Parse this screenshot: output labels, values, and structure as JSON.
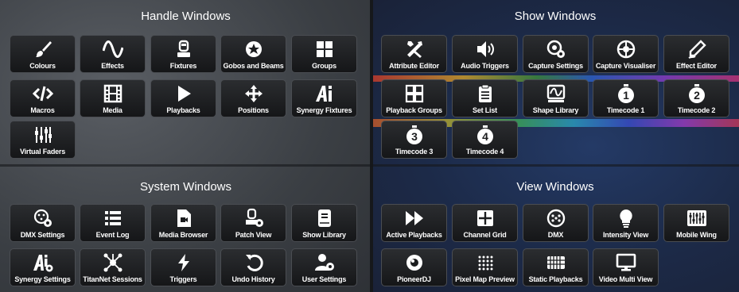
{
  "sections": {
    "handle": {
      "title": "Handle Windows",
      "items": [
        {
          "label": "Colours",
          "icon": "brush-icon"
        },
        {
          "label": "Effects",
          "icon": "sine-wave-icon"
        },
        {
          "label": "Fixtures",
          "icon": "fixture-icon"
        },
        {
          "label": "Gobos and Beams",
          "icon": "gobo-icon"
        },
        {
          "label": "Groups",
          "icon": "grid-four-icon"
        },
        {
          "label": "Macros",
          "icon": "code-icon"
        },
        {
          "label": "Media",
          "icon": "film-icon"
        },
        {
          "label": "Playbacks",
          "icon": "play-icon"
        },
        {
          "label": "Positions",
          "icon": "move-arrows-icon"
        },
        {
          "label": "Synergy Fixtures",
          "icon": "synergy-ai-icon"
        },
        {
          "label": "Virtual Faders",
          "icon": "faders-icon"
        }
      ]
    },
    "show": {
      "title": "Show Windows",
      "items": [
        {
          "label": "Attribute Editor",
          "icon": "tools-icon"
        },
        {
          "label": "Audio Triggers",
          "icon": "speaker-icon"
        },
        {
          "label": "Capture Settings",
          "icon": "capture-settings-icon"
        },
        {
          "label": "Capture Visualiser",
          "icon": "capture-icon"
        },
        {
          "label": "Effect Editor",
          "icon": "pen-icon"
        },
        {
          "label": "Playback Groups",
          "icon": "playback-groups-icon"
        },
        {
          "label": "Set List",
          "icon": "clipboard-list-icon"
        },
        {
          "label": "Shape Library",
          "icon": "shape-icon"
        },
        {
          "label": "Timecode 1",
          "icon": "stopwatch-1-icon",
          "num": "1"
        },
        {
          "label": "Timecode 2",
          "icon": "stopwatch-2-icon",
          "num": "2"
        },
        {
          "label": "Timecode 3",
          "icon": "stopwatch-3-icon",
          "num": "3"
        },
        {
          "label": "Timecode 4",
          "icon": "stopwatch-4-icon",
          "num": "4"
        }
      ]
    },
    "system": {
      "title": "System Windows",
      "items": [
        {
          "label": "DMX Settings",
          "icon": "dmx-settings-icon"
        },
        {
          "label": "Event Log",
          "icon": "list-icon"
        },
        {
          "label": "Media Browser",
          "icon": "media-file-icon"
        },
        {
          "label": "Patch View",
          "icon": "patch-icon"
        },
        {
          "label": "Show Library",
          "icon": "book-icon"
        },
        {
          "label": "Synergy Settings",
          "icon": "synergy-settings-icon"
        },
        {
          "label": "TitanNet Sessions",
          "icon": "network-icon"
        },
        {
          "label": "Triggers",
          "icon": "bolt-icon"
        },
        {
          "label": "Undo History",
          "icon": "undo-icon"
        },
        {
          "label": "User Settings",
          "icon": "user-settings-icon"
        }
      ]
    },
    "view": {
      "title": "View Windows",
      "items": [
        {
          "label": "Active Playbacks",
          "icon": "fast-forward-icon"
        },
        {
          "label": "Channel Grid",
          "icon": "channel-grid-icon"
        },
        {
          "label": "DMX",
          "icon": "dmx-connector-icon"
        },
        {
          "label": "Intensity View",
          "icon": "bulb-icon"
        },
        {
          "label": "Mobile Wing",
          "icon": "mobile-wing-icon"
        },
        {
          "label": "PioneerDJ",
          "icon": "pioneer-icon"
        },
        {
          "label": "Pixel Map Preview",
          "icon": "pixel-grid-icon"
        },
        {
          "label": "Static Playbacks",
          "icon": "static-grid-icon"
        },
        {
          "label": "Video Multi View",
          "icon": "monitor-icon"
        }
      ]
    }
  }
}
